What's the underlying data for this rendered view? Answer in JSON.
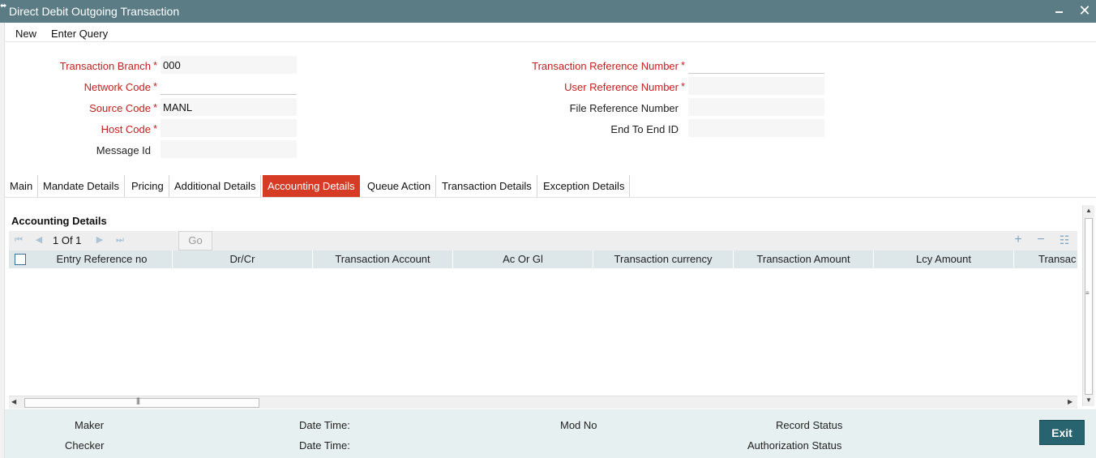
{
  "window": {
    "title": "Direct Debit Outgoing Transaction"
  },
  "menu": {
    "items": [
      "New",
      "Enter Query"
    ]
  },
  "form": {
    "transaction_branch": {
      "label": "Transaction Branch",
      "value": "000"
    },
    "network_code": {
      "label": "Network Code",
      "value": ""
    },
    "source_code": {
      "label": "Source Code",
      "value": "MANL"
    },
    "host_code": {
      "label": "Host Code",
      "value": ""
    },
    "message_id": {
      "label": "Message Id",
      "value": ""
    },
    "transaction_reference_number": {
      "label": "Transaction Reference Number",
      "value": ""
    },
    "user_reference_number": {
      "label": "User Reference Number",
      "value": ""
    },
    "file_reference_number": {
      "label": "File Reference Number",
      "value": ""
    },
    "end_to_end_id": {
      "label": "End To End ID",
      "value": ""
    },
    "required_mark": "*"
  },
  "tabs": [
    {
      "label": "Main",
      "active": false
    },
    {
      "label": "Mandate Details",
      "active": false
    },
    {
      "label": "Pricing",
      "active": false
    },
    {
      "label": "Additional Details",
      "active": false
    },
    {
      "label": "Accounting Details",
      "active": true
    },
    {
      "label": "Queue Action",
      "active": false
    },
    {
      "label": "Transaction Details",
      "active": false
    },
    {
      "label": "Exception Details",
      "active": false
    }
  ],
  "accounting": {
    "section_title": "Accounting Details",
    "pagination": {
      "info": "1 Of 1",
      "go_label": "Go"
    },
    "columns": [
      "Entry Reference no",
      "Dr/Cr",
      "Transaction Account",
      "Ac Or Gl",
      "Transaction currency",
      "Transaction Amount",
      "Lcy Amount",
      "Transac"
    ],
    "rows": []
  },
  "footer": {
    "maker_label": "Maker",
    "checker_label": "Checker",
    "date_time_label_1": "Date Time:",
    "date_time_label_2": "Date Time:",
    "mod_no_label": "Mod No",
    "record_status_label": "Record Status",
    "authorization_status_label": "Authorization Status",
    "exit_label": "Exit"
  },
  "icons": {
    "close": "close-icon",
    "minimize": "minimize-icon",
    "first_page": "first-page-icon",
    "prev_page": "prev-page-icon",
    "next_page": "next-page-icon",
    "last_page": "last-page-icon",
    "add_row": "plus-icon",
    "delete_row": "minus-icon",
    "single_view": "list-icon"
  },
  "colors": {
    "titlebar": "#5b7c85",
    "required": "#c41e1e",
    "active_tab": "#d63b25",
    "grid_header": "#dde7ea",
    "footer": "#e7f0f1",
    "exit_button": "#27646f"
  }
}
